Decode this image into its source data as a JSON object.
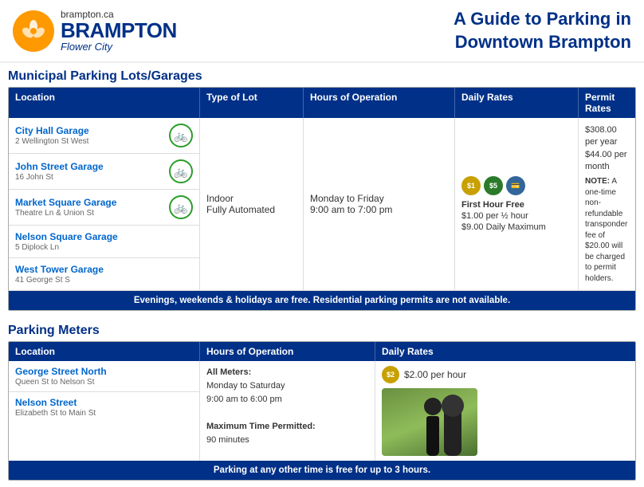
{
  "header": {
    "logo_brampton": "BRAMPTON",
    "logo_flower": "Flower City",
    "logo_dotca": "brampton.ca",
    "title_line1": "A Guide to Parking in",
    "title_line2": "Downtown Brampton"
  },
  "garages": {
    "section_title": "Municipal Parking Lots/Garages",
    "columns": [
      "Location",
      "Type of Lot",
      "Hours of Operation",
      "Daily Rates",
      "Permit Rates"
    ],
    "locations": [
      {
        "name": "City Hall Garage",
        "sub": "2 Wellington St West",
        "bike": true
      },
      {
        "name": "John Street Garage",
        "sub": "16 John St",
        "bike": true
      },
      {
        "name": "Market Square Garage",
        "sub": "Theatre Ln & Union St",
        "bike": true
      },
      {
        "name": "Nelson Square Garage",
        "sub": "5 Diplock Ln",
        "bike": false
      },
      {
        "name": "West Tower Garage",
        "sub": "41 George St S",
        "bike": false
      }
    ],
    "type_of_lot": "Indoor\nFully Automated",
    "hours": "Monday to Friday\n9:00 am to 7:00 pm",
    "daily_rates": {
      "label1": "First Hour Free",
      "label2": "$1.00 per ½ hour",
      "label3": "$9.00 Daily Maximum"
    },
    "permit_rates": {
      "line1": "$308.00 per year",
      "line2": "$44.00 per month",
      "note_label": "NOTE:",
      "note_text": " A one-time non-refundable transponder fee of $20.00 will be charged to permit holders."
    },
    "notice": "Evenings, weekends & holidays are free. Residential parking permits are not available."
  },
  "meters": {
    "section_title": "Parking Meters",
    "columns": [
      "Location",
      "Hours of Operation",
      "Daily Rates"
    ],
    "locations": [
      {
        "name": "George Street North",
        "sub": "Queen St to Nelson St"
      },
      {
        "name": "Nelson Street",
        "sub": "Elizabeth St to Main St"
      }
    ],
    "hours": {
      "bold_label": "All Meters:",
      "line1": "Monday to Saturday",
      "line2": "9:00 am to 6:00 pm",
      "max_label": "Maximum Time Permitted:",
      "max_value": "90 minutes"
    },
    "daily_rate": "$2.00 per hour",
    "notice": "Parking at any other time is free for up to 3 hours."
  }
}
